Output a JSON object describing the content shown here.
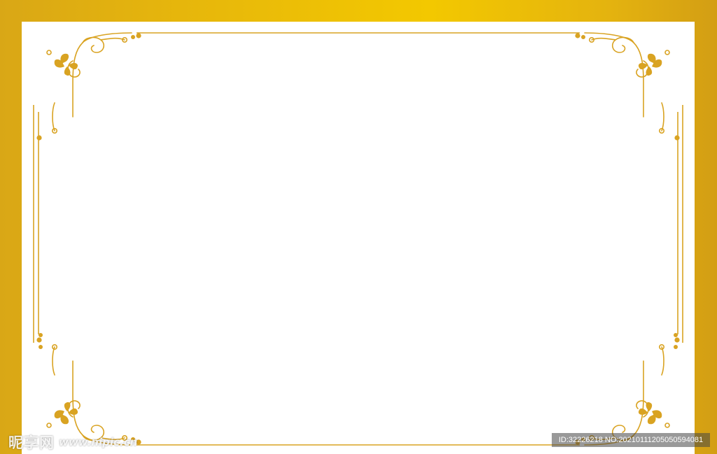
{
  "watermark": {
    "logo_text": "昵享网",
    "site_text": "www.nipic.cn",
    "id_text": "ID:32226218 NO:20210111205050594081"
  },
  "colors": {
    "outer_border_gold": "#e6b60c",
    "ornament_gold": "#d9a322",
    "paper": "#ffffff"
  },
  "icons": {
    "corner_ornament": "floral-scroll-corner-icon"
  }
}
